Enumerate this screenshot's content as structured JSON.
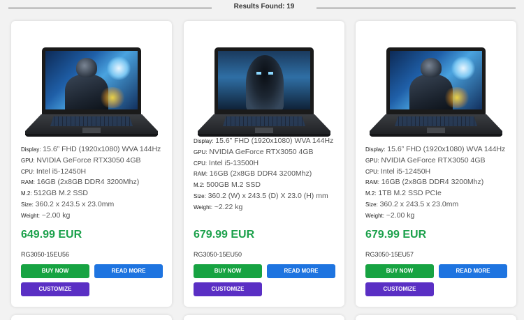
{
  "results": {
    "label": "Results Found: 19"
  },
  "buttons": {
    "buy": "BUY NOW",
    "read_more": "READ MORE",
    "customize": "CUSTOMIZE"
  },
  "spec_keys": {
    "display": "Display:",
    "gpu": "GPU:",
    "cpu": "CPU:",
    "ram": "RAM:",
    "storage": "M.2:",
    "size": "Size:",
    "weight": "Weight:"
  },
  "products": [
    {
      "display": "15.6” FHD (1920x1080) WVA 144Hz",
      "gpu": "NVIDIA GeForce RTX3050 4GB",
      "cpu": "Intel i5-12450H",
      "ram": "16GB (2x8GB DDR4 3200Mhz)",
      "storage": "512GB M.2 SSD",
      "size": "360.2 x 243.5 x 23.0mm",
      "weight": "~2.00 kg",
      "price": "649.99 EUR",
      "sku": "RG3050-15EU56"
    },
    {
      "display": "15.6” FHD (1920x1080) WVA 144Hz",
      "gpu": "NVIDIA GeForce RTX3050 4GB",
      "cpu": "Intel i5-13500H",
      "ram": "16GB (2x8GB DDR4 3200Mhz)",
      "storage": "500GB M.2 SSD",
      "size": "360.2 (W) x 243.5 (D) X 23.0 (H) mm",
      "weight": "~2.22 kg",
      "price": "679.99 EUR",
      "sku": "RG3050-15EU50"
    },
    {
      "display": "15.6” FHD (1920x1080) WVA 144Hz",
      "gpu": "NVIDIA GeForce RTX3050 4GB",
      "cpu": "Intel i5-12450H",
      "ram": "16GB (2x8GB DDR4 3200Mhz)",
      "storage": "1TB M.2 SSD PCIe",
      "size": "360.2 x 243.5 x 23.0mm",
      "weight": "~2.00 kg",
      "price": "679.99 EUR",
      "sku": "RG3050-15EU57"
    }
  ],
  "colors": {
    "price": "#1aa04a",
    "buy": "#17a342",
    "read_more": "#1e74e0",
    "customize": "#5a2fc4"
  }
}
